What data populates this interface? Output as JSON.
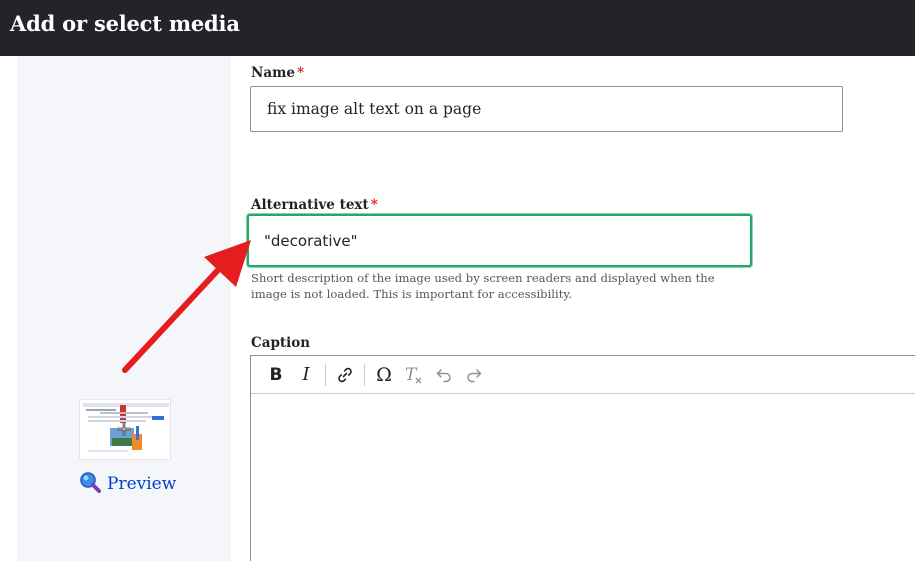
{
  "dialog": {
    "title": "Add or select media"
  },
  "sidebar": {
    "preview_label": "Preview",
    "thumbnail_icon": "media-thumbnail"
  },
  "form": {
    "name": {
      "label": "Name",
      "required_mark": "*",
      "value": "fix image alt text on a page"
    },
    "alt_text": {
      "label": "Alternative text",
      "required_mark": "*",
      "value": "\"decorative\"",
      "description": "Short description of the image used by screen readers and displayed when the image is not loaded. This is important for accessibility."
    },
    "caption": {
      "label": "Caption",
      "toolbar": {
        "bold_label": "B",
        "italic_label": "I",
        "link_icon": "link-icon",
        "special_char_label": "Ω",
        "remove_format_icon": "remove-format-icon",
        "undo_icon": "undo-icon",
        "redo_icon": "redo-icon"
      }
    }
  },
  "annotation": {
    "arrow_color": "#e41e1e"
  },
  "colors": {
    "titlebar": "#232429",
    "focus_ring": "#26a769",
    "link": "#003ecc",
    "required": "#dc2323"
  }
}
